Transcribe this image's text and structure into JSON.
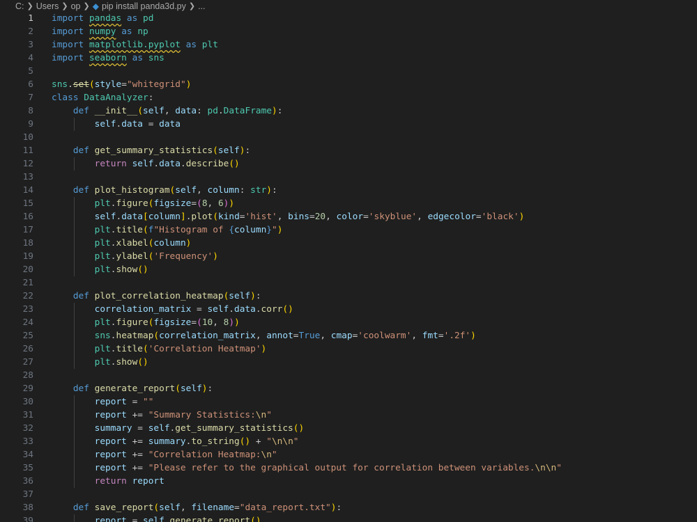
{
  "breadcrumb": [
    "C:",
    "Users",
    "op",
    "pip install panda3d.py",
    "..."
  ],
  "active_line": 1,
  "lines": [
    [
      [
        "kw",
        "import"
      ],
      [
        "pl",
        " "
      ],
      [
        "cls sq",
        "pandas"
      ],
      [
        "pl",
        " "
      ],
      [
        "kw",
        "as"
      ],
      [
        "pl",
        " "
      ],
      [
        "cls",
        "pd"
      ]
    ],
    [
      [
        "kw",
        "import"
      ],
      [
        "pl",
        " "
      ],
      [
        "cls sq",
        "numpy"
      ],
      [
        "pl",
        " "
      ],
      [
        "kw",
        "as"
      ],
      [
        "pl",
        " "
      ],
      [
        "cls",
        "np"
      ]
    ],
    [
      [
        "kw",
        "import"
      ],
      [
        "pl",
        " "
      ],
      [
        "cls sq",
        "matplotlib.pyplot"
      ],
      [
        "pl",
        " "
      ],
      [
        "kw",
        "as"
      ],
      [
        "pl",
        " "
      ],
      [
        "cls",
        "plt"
      ]
    ],
    [
      [
        "kw",
        "import"
      ],
      [
        "pl",
        " "
      ],
      [
        "cls sq",
        "seaborn"
      ],
      [
        "pl",
        " "
      ],
      [
        "kw",
        "as"
      ],
      [
        "pl",
        " "
      ],
      [
        "cls",
        "sns"
      ]
    ],
    [],
    [
      [
        "cls",
        "sns"
      ],
      [
        "pl",
        "."
      ],
      [
        "fn strike",
        "set"
      ],
      [
        "br1",
        "("
      ],
      [
        "var",
        "style"
      ],
      [
        "pl",
        "="
      ],
      [
        "str",
        "\"whitegrid\""
      ],
      [
        "br1",
        ")"
      ]
    ],
    [
      [
        "kw",
        "class"
      ],
      [
        "pl",
        " "
      ],
      [
        "cls",
        "DataAnalyzer"
      ],
      [
        "pl",
        ":"
      ]
    ],
    [
      [
        "pl",
        "    "
      ],
      [
        "kw",
        "def"
      ],
      [
        "pl",
        " "
      ],
      [
        "fn",
        "__init__"
      ],
      [
        "br1",
        "("
      ],
      [
        "var",
        "self"
      ],
      [
        "pl",
        ", "
      ],
      [
        "var",
        "data"
      ],
      [
        "pl",
        ": "
      ],
      [
        "cls",
        "pd"
      ],
      [
        "pl",
        "."
      ],
      [
        "cls",
        "DataFrame"
      ],
      [
        "br1",
        ")"
      ],
      [
        "pl",
        ":"
      ]
    ],
    [
      [
        "pl",
        "        "
      ],
      [
        "var",
        "self"
      ],
      [
        "pl",
        "."
      ],
      [
        "var",
        "data"
      ],
      [
        "pl",
        " = "
      ],
      [
        "var",
        "data"
      ]
    ],
    [],
    [
      [
        "pl",
        "    "
      ],
      [
        "kw",
        "def"
      ],
      [
        "pl",
        " "
      ],
      [
        "fn",
        "get_summary_statistics"
      ],
      [
        "br1",
        "("
      ],
      [
        "var",
        "self"
      ],
      [
        "br1",
        ")"
      ],
      [
        "pl",
        ":"
      ]
    ],
    [
      [
        "pl",
        "        "
      ],
      [
        "ctl",
        "return"
      ],
      [
        "pl",
        " "
      ],
      [
        "var",
        "self"
      ],
      [
        "pl",
        "."
      ],
      [
        "var",
        "data"
      ],
      [
        "pl",
        "."
      ],
      [
        "fn",
        "describe"
      ],
      [
        "br1",
        "()"
      ]
    ],
    [],
    [
      [
        "pl",
        "    "
      ],
      [
        "kw",
        "def"
      ],
      [
        "pl",
        " "
      ],
      [
        "fn",
        "plot_histogram"
      ],
      [
        "br1",
        "("
      ],
      [
        "var",
        "self"
      ],
      [
        "pl",
        ", "
      ],
      [
        "var",
        "column"
      ],
      [
        "pl",
        ": "
      ],
      [
        "cls",
        "str"
      ],
      [
        "br1",
        ")"
      ],
      [
        "pl",
        ":"
      ]
    ],
    [
      [
        "pl",
        "        "
      ],
      [
        "cls",
        "plt"
      ],
      [
        "pl",
        "."
      ],
      [
        "fn",
        "figure"
      ],
      [
        "br1",
        "("
      ],
      [
        "var",
        "figsize"
      ],
      [
        "pl",
        "="
      ],
      [
        "br2",
        "("
      ],
      [
        "num",
        "8"
      ],
      [
        "pl",
        ", "
      ],
      [
        "num",
        "6"
      ],
      [
        "br2",
        ")"
      ],
      [
        "br1",
        ")"
      ]
    ],
    [
      [
        "pl",
        "        "
      ],
      [
        "var",
        "self"
      ],
      [
        "pl",
        "."
      ],
      [
        "var",
        "data"
      ],
      [
        "br1",
        "["
      ],
      [
        "var",
        "column"
      ],
      [
        "br1",
        "]"
      ],
      [
        "pl",
        "."
      ],
      [
        "fn",
        "plot"
      ],
      [
        "br1",
        "("
      ],
      [
        "var",
        "kind"
      ],
      [
        "pl",
        "="
      ],
      [
        "str",
        "'hist'"
      ],
      [
        "pl",
        ", "
      ],
      [
        "var",
        "bins"
      ],
      [
        "pl",
        "="
      ],
      [
        "num",
        "20"
      ],
      [
        "pl",
        ", "
      ],
      [
        "var",
        "color"
      ],
      [
        "pl",
        "="
      ],
      [
        "str",
        "'skyblue'"
      ],
      [
        "pl",
        ", "
      ],
      [
        "var",
        "edgecolor"
      ],
      [
        "pl",
        "="
      ],
      [
        "str",
        "'black'"
      ],
      [
        "br1",
        ")"
      ]
    ],
    [
      [
        "pl",
        "        "
      ],
      [
        "cls",
        "plt"
      ],
      [
        "pl",
        "."
      ],
      [
        "fn",
        "title"
      ],
      [
        "br1",
        "("
      ],
      [
        "kw",
        "f"
      ],
      [
        "str",
        "\"Histogram of "
      ],
      [
        "kw",
        "{"
      ],
      [
        "var",
        "column"
      ],
      [
        "kw",
        "}"
      ],
      [
        "str",
        "\""
      ],
      [
        "br1",
        ")"
      ]
    ],
    [
      [
        "pl",
        "        "
      ],
      [
        "cls",
        "plt"
      ],
      [
        "pl",
        "."
      ],
      [
        "fn",
        "xlabel"
      ],
      [
        "br1",
        "("
      ],
      [
        "var",
        "column"
      ],
      [
        "br1",
        ")"
      ]
    ],
    [
      [
        "pl",
        "        "
      ],
      [
        "cls",
        "plt"
      ],
      [
        "pl",
        "."
      ],
      [
        "fn",
        "ylabel"
      ],
      [
        "br1",
        "("
      ],
      [
        "str",
        "'Frequency'"
      ],
      [
        "br1",
        ")"
      ]
    ],
    [
      [
        "pl",
        "        "
      ],
      [
        "cls",
        "plt"
      ],
      [
        "pl",
        "."
      ],
      [
        "fn",
        "show"
      ],
      [
        "br1",
        "()"
      ]
    ],
    [],
    [
      [
        "pl",
        "    "
      ],
      [
        "kw",
        "def"
      ],
      [
        "pl",
        " "
      ],
      [
        "fn",
        "plot_correlation_heatmap"
      ],
      [
        "br1",
        "("
      ],
      [
        "var",
        "self"
      ],
      [
        "br1",
        ")"
      ],
      [
        "pl",
        ":"
      ]
    ],
    [
      [
        "pl",
        "        "
      ],
      [
        "var",
        "correlation_matrix"
      ],
      [
        "pl",
        " = "
      ],
      [
        "var",
        "self"
      ],
      [
        "pl",
        "."
      ],
      [
        "var",
        "data"
      ],
      [
        "pl",
        "."
      ],
      [
        "fn",
        "corr"
      ],
      [
        "br1",
        "()"
      ]
    ],
    [
      [
        "pl",
        "        "
      ],
      [
        "cls",
        "plt"
      ],
      [
        "pl",
        "."
      ],
      [
        "fn",
        "figure"
      ],
      [
        "br1",
        "("
      ],
      [
        "var",
        "figsize"
      ],
      [
        "pl",
        "="
      ],
      [
        "br2",
        "("
      ],
      [
        "num",
        "10"
      ],
      [
        "pl",
        ", "
      ],
      [
        "num",
        "8"
      ],
      [
        "br2",
        ")"
      ],
      [
        "br1",
        ")"
      ]
    ],
    [
      [
        "pl",
        "        "
      ],
      [
        "cls",
        "sns"
      ],
      [
        "pl",
        "."
      ],
      [
        "fn",
        "heatmap"
      ],
      [
        "br1",
        "("
      ],
      [
        "var",
        "correlation_matrix"
      ],
      [
        "pl",
        ", "
      ],
      [
        "var",
        "annot"
      ],
      [
        "pl",
        "="
      ],
      [
        "bool",
        "True"
      ],
      [
        "pl",
        ", "
      ],
      [
        "var",
        "cmap"
      ],
      [
        "pl",
        "="
      ],
      [
        "str",
        "'coolwarm'"
      ],
      [
        "pl",
        ", "
      ],
      [
        "var",
        "fmt"
      ],
      [
        "pl",
        "="
      ],
      [
        "str",
        "'.2f'"
      ],
      [
        "br1",
        ")"
      ]
    ],
    [
      [
        "pl",
        "        "
      ],
      [
        "cls",
        "plt"
      ],
      [
        "pl",
        "."
      ],
      [
        "fn",
        "title"
      ],
      [
        "br1",
        "("
      ],
      [
        "str",
        "'Correlation Heatmap'"
      ],
      [
        "br1",
        ")"
      ]
    ],
    [
      [
        "pl",
        "        "
      ],
      [
        "cls",
        "plt"
      ],
      [
        "pl",
        "."
      ],
      [
        "fn",
        "show"
      ],
      [
        "br1",
        "()"
      ]
    ],
    [],
    [
      [
        "pl",
        "    "
      ],
      [
        "kw",
        "def"
      ],
      [
        "pl",
        " "
      ],
      [
        "fn",
        "generate_report"
      ],
      [
        "br1",
        "("
      ],
      [
        "var",
        "self"
      ],
      [
        "br1",
        ")"
      ],
      [
        "pl",
        ":"
      ]
    ],
    [
      [
        "pl",
        "        "
      ],
      [
        "var",
        "report"
      ],
      [
        "pl",
        " = "
      ],
      [
        "str",
        "\"\""
      ]
    ],
    [
      [
        "pl",
        "        "
      ],
      [
        "var",
        "report"
      ],
      [
        "pl",
        " += "
      ],
      [
        "str",
        "\"Summary Statistics:"
      ],
      [
        "esc",
        "\\n"
      ],
      [
        "str",
        "\""
      ]
    ],
    [
      [
        "pl",
        "        "
      ],
      [
        "var",
        "summary"
      ],
      [
        "pl",
        " = "
      ],
      [
        "var",
        "self"
      ],
      [
        "pl",
        "."
      ],
      [
        "fn",
        "get_summary_statistics"
      ],
      [
        "br1",
        "()"
      ]
    ],
    [
      [
        "pl",
        "        "
      ],
      [
        "var",
        "report"
      ],
      [
        "pl",
        " += "
      ],
      [
        "var",
        "summary"
      ],
      [
        "pl",
        "."
      ],
      [
        "fn",
        "to_string"
      ],
      [
        "br1",
        "()"
      ],
      [
        "pl",
        " + "
      ],
      [
        "str",
        "\""
      ],
      [
        "esc",
        "\\n\\n"
      ],
      [
        "str",
        "\""
      ]
    ],
    [
      [
        "pl",
        "        "
      ],
      [
        "var",
        "report"
      ],
      [
        "pl",
        " += "
      ],
      [
        "str",
        "\"Correlation Heatmap:"
      ],
      [
        "esc",
        "\\n"
      ],
      [
        "str",
        "\""
      ]
    ],
    [
      [
        "pl",
        "        "
      ],
      [
        "var",
        "report"
      ],
      [
        "pl",
        " += "
      ],
      [
        "str",
        "\"Please refer to the graphical output for correlation between variables."
      ],
      [
        "esc",
        "\\n\\n"
      ],
      [
        "str",
        "\""
      ]
    ],
    [
      [
        "pl",
        "        "
      ],
      [
        "ctl",
        "return"
      ],
      [
        "pl",
        " "
      ],
      [
        "var",
        "report"
      ]
    ],
    [],
    [
      [
        "pl",
        "    "
      ],
      [
        "kw",
        "def"
      ],
      [
        "pl",
        " "
      ],
      [
        "fn",
        "save_report"
      ],
      [
        "br1",
        "("
      ],
      [
        "var",
        "self"
      ],
      [
        "pl",
        ", "
      ],
      [
        "var",
        "filename"
      ],
      [
        "pl",
        "="
      ],
      [
        "str",
        "\"data_report.txt\""
      ],
      [
        "br1",
        ")"
      ],
      [
        "pl",
        ":"
      ]
    ],
    [
      [
        "pl",
        "        "
      ],
      [
        "var",
        "report"
      ],
      [
        "pl",
        " = "
      ],
      [
        "var",
        "self"
      ],
      [
        "pl",
        "."
      ],
      [
        "fn",
        "generate_report"
      ],
      [
        "br1",
        "()"
      ]
    ]
  ]
}
